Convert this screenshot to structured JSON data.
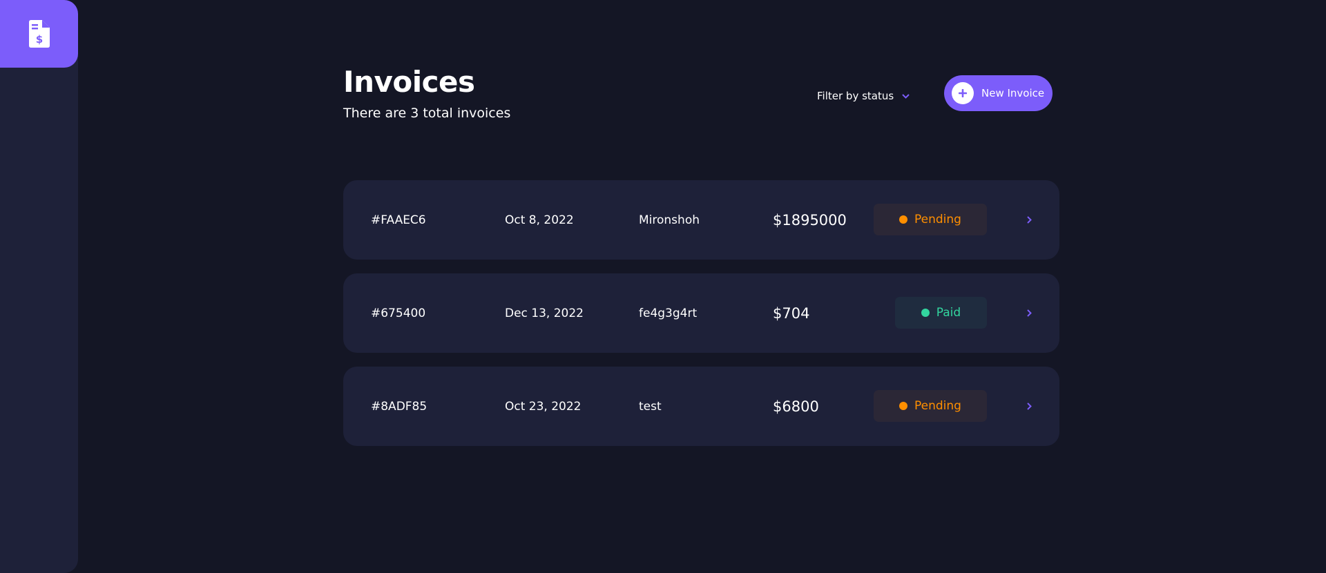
{
  "sidebar": {
    "logo_icon": "invoice-dollar-icon"
  },
  "header": {
    "title": "Invoices",
    "subtitle": "There are 3 total invoices",
    "filter_label": "Filter by status",
    "new_button_label": "New Invoice"
  },
  "invoices": [
    {
      "id": "#FAAEC6",
      "date": "Oct 8, 2022",
      "client": "Mironshoh",
      "amount": "$1895000",
      "status": "Pending"
    },
    {
      "id": "#675400",
      "date": "Dec 13, 2022",
      "client": "fe4g3g4rt",
      "amount": "$704",
      "status": "Paid"
    },
    {
      "id": "#8ADF85",
      "date": "Oct 23, 2022",
      "client": "test",
      "amount": "$6800",
      "status": "Pending"
    }
  ],
  "colors": {
    "background": "#141625",
    "surface": "#1e2139",
    "accent": "#7c5dfa",
    "pending": "#ff8f00",
    "paid": "#33d69f"
  }
}
